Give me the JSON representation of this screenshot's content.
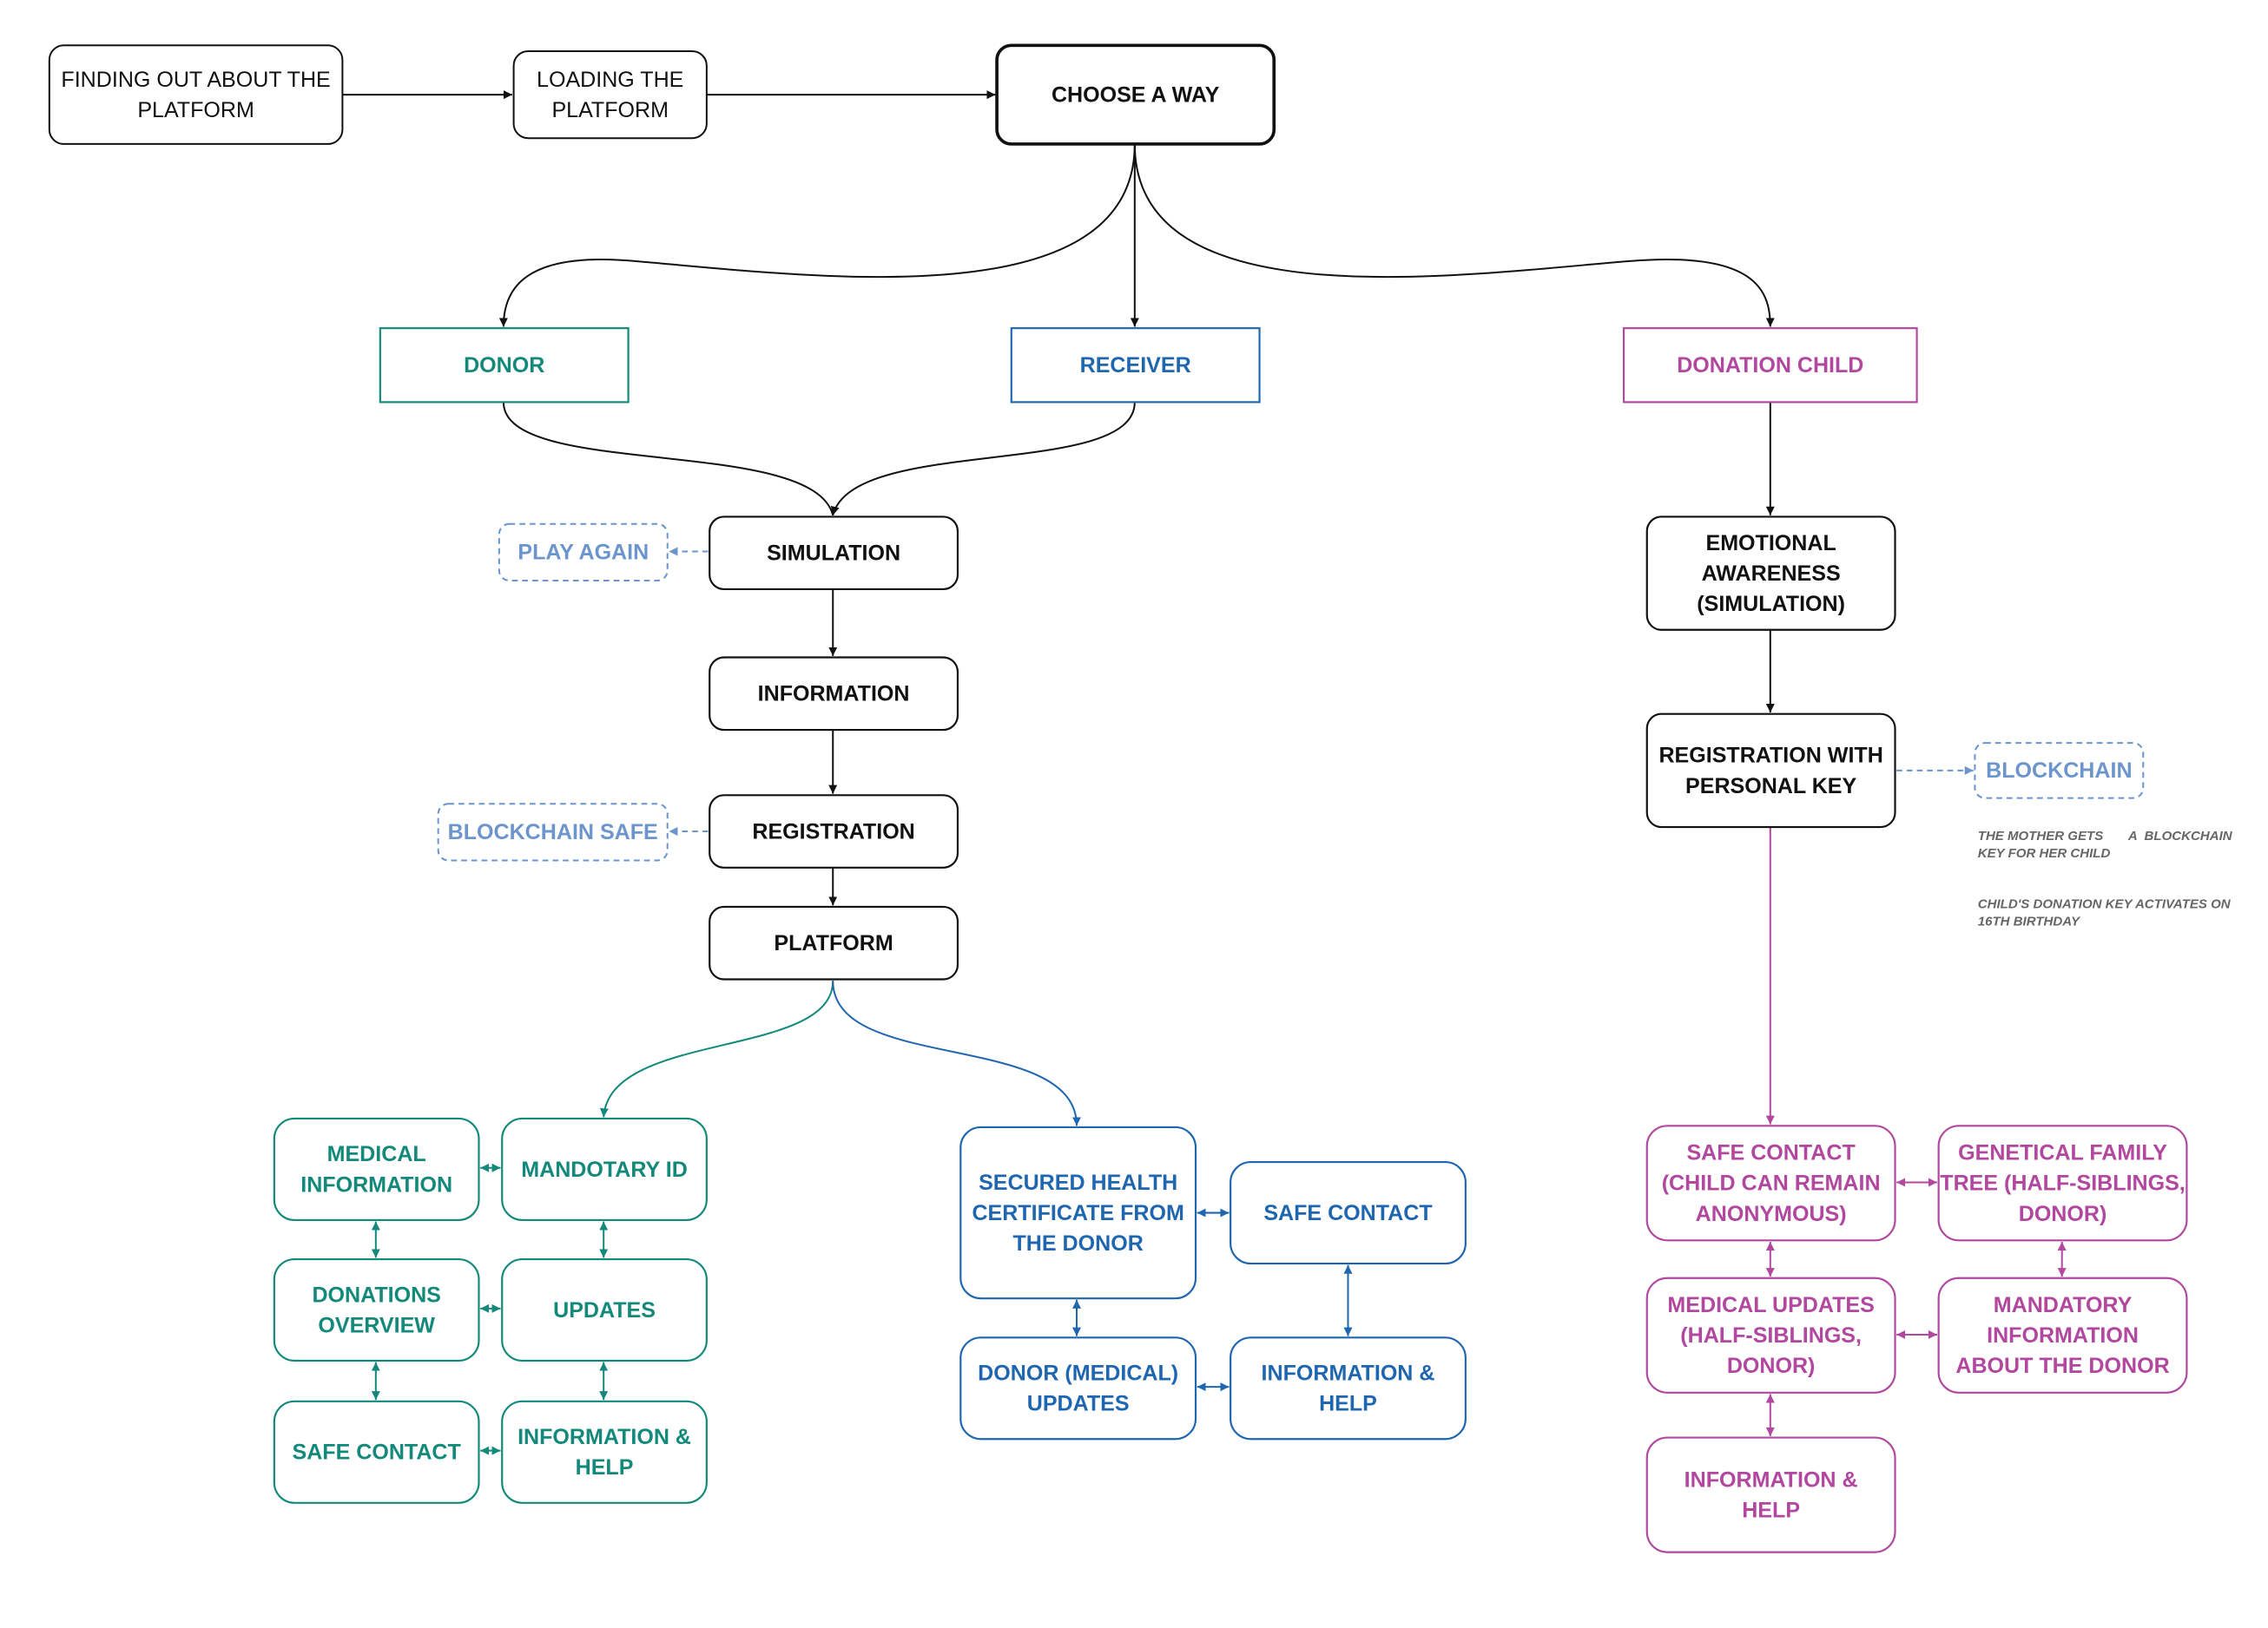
{
  "colors": {
    "black": "#111111",
    "teal": "#12897a",
    "blue": "#1f66b0",
    "magenta": "#b2479f",
    "dashed_blue": "#6b95cc",
    "note_gray": "#666666"
  },
  "nodes": [
    {
      "id": "find",
      "style": "plain",
      "lines": [
        "FINDING OUT ABOUT THE",
        "PLATFORM"
      ]
    },
    {
      "id": "load",
      "style": "plain",
      "lines": [
        "LOADING THE",
        "PLATFORM"
      ]
    },
    {
      "id": "choose",
      "style": "main",
      "lines": [
        "CHOOSE A WAY"
      ]
    },
    {
      "id": "donor",
      "style": "teal-square",
      "lines": [
        "DONOR"
      ]
    },
    {
      "id": "receiver",
      "style": "blue-square",
      "lines": [
        "RECEIVER"
      ]
    },
    {
      "id": "dchild",
      "style": "magenta-square",
      "lines": [
        "DONATION CHILD"
      ]
    },
    {
      "id": "sim",
      "style": "black",
      "lines": [
        "SIMULATION"
      ]
    },
    {
      "id": "playagain",
      "style": "dashed",
      "lines": [
        "PLAY AGAIN"
      ]
    },
    {
      "id": "info",
      "style": "black",
      "lines": [
        "INFORMATION"
      ]
    },
    {
      "id": "reg",
      "style": "black",
      "lines": [
        "REGISTRATION"
      ]
    },
    {
      "id": "bsafe",
      "style": "dashed",
      "lines": [
        "BLOCKCHAIN SAFE"
      ]
    },
    {
      "id": "platform",
      "style": "black",
      "lines": [
        "PLATFORM"
      ]
    },
    {
      "id": "emo",
      "style": "black",
      "lines": [
        "EMOTIONAL",
        "AWARENESS",
        "(SIMULATION)"
      ]
    },
    {
      "id": "regkey",
      "style": "black",
      "lines": [
        "REGISTRATION WITH",
        "PERSONAL KEY"
      ]
    },
    {
      "id": "blockchain",
      "style": "dashed",
      "lines": [
        "BLOCKCHAIN"
      ]
    },
    {
      "id": "t_med",
      "style": "teal",
      "lines": [
        "MEDICAL",
        "INFORMATION"
      ]
    },
    {
      "id": "t_mand",
      "style": "teal",
      "lines": [
        "MANDOTARY ID"
      ]
    },
    {
      "id": "t_don",
      "style": "teal",
      "lines": [
        "DONATIONS",
        "OVERVIEW"
      ]
    },
    {
      "id": "t_upd",
      "style": "teal",
      "lines": [
        "UPDATES"
      ]
    },
    {
      "id": "t_safe",
      "style": "teal",
      "lines": [
        "SAFE CONTACT"
      ]
    },
    {
      "id": "t_help",
      "style": "teal",
      "lines": [
        "INFORMATION &",
        "HELP"
      ]
    },
    {
      "id": "b_cert",
      "style": "blue",
      "lines": [
        "SECURED HEALTH",
        "CERTIFICATE FROM",
        "THE DONOR"
      ]
    },
    {
      "id": "b_safe",
      "style": "blue",
      "lines": [
        "SAFE CONTACT"
      ]
    },
    {
      "id": "b_upd",
      "style": "blue",
      "lines": [
        "DONOR  (MEDICAL)",
        "UPDATES"
      ]
    },
    {
      "id": "b_help",
      "style": "blue",
      "lines": [
        "INFORMATION &",
        "HELP"
      ]
    },
    {
      "id": "m_safe",
      "style": "magenta",
      "lines": [
        "SAFE CONTACT",
        "(CHILD CAN REMAIN",
        "ANONYMOUS)"
      ]
    },
    {
      "id": "m_tree",
      "style": "magenta",
      "lines": [
        "GENETICAL FAMILY",
        "TREE (HALF-SIBLINGS,",
        "DONOR)"
      ]
    },
    {
      "id": "m_upd",
      "style": "magenta",
      "lines": [
        "MEDICAL UPDATES",
        "(HALF-SIBLINGS,",
        "DONOR)"
      ]
    },
    {
      "id": "m_mand",
      "style": "magenta",
      "lines": [
        "MANDATORY",
        "INFORMATION",
        "ABOUT THE DONOR"
      ]
    },
    {
      "id": "m_help",
      "style": "magenta",
      "lines": [
        "INFORMATION &",
        "HELP"
      ]
    }
  ],
  "notes": {
    "mother_key": [
      "THE MOTHER GETS       A  BLOCKCHAIN",
      "KEY FOR HER CHILD"
    ],
    "activation": [
      "CHILD'S DONATION KEY ACTIVATES ON",
      "16TH BIRTHDAY"
    ]
  }
}
